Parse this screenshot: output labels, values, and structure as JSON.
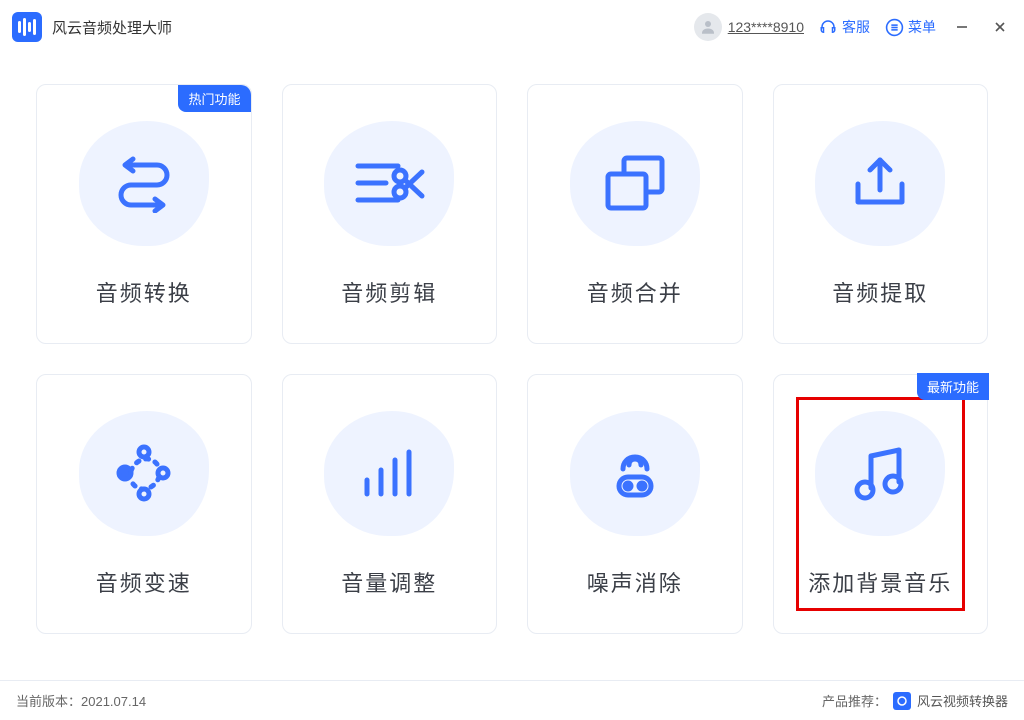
{
  "app": {
    "name": "风云音频处理大师"
  },
  "header": {
    "user_name": "123****8910",
    "support_label": "客服",
    "menu_label": "菜单"
  },
  "badges": {
    "hot": "热门功能",
    "new": "最新功能"
  },
  "cards": [
    {
      "label": "音频转换"
    },
    {
      "label": "音频剪辑"
    },
    {
      "label": "音频合并"
    },
    {
      "label": "音频提取"
    },
    {
      "label": "音频变速"
    },
    {
      "label": "音量调整"
    },
    {
      "label": "噪声消除"
    },
    {
      "label": "添加背景音乐"
    }
  ],
  "footer": {
    "version_prefix": "当前版本：",
    "version": "2021.07.14",
    "recommend_prefix": "产品推荐：",
    "recommend_name": "风云视频转换器"
  }
}
